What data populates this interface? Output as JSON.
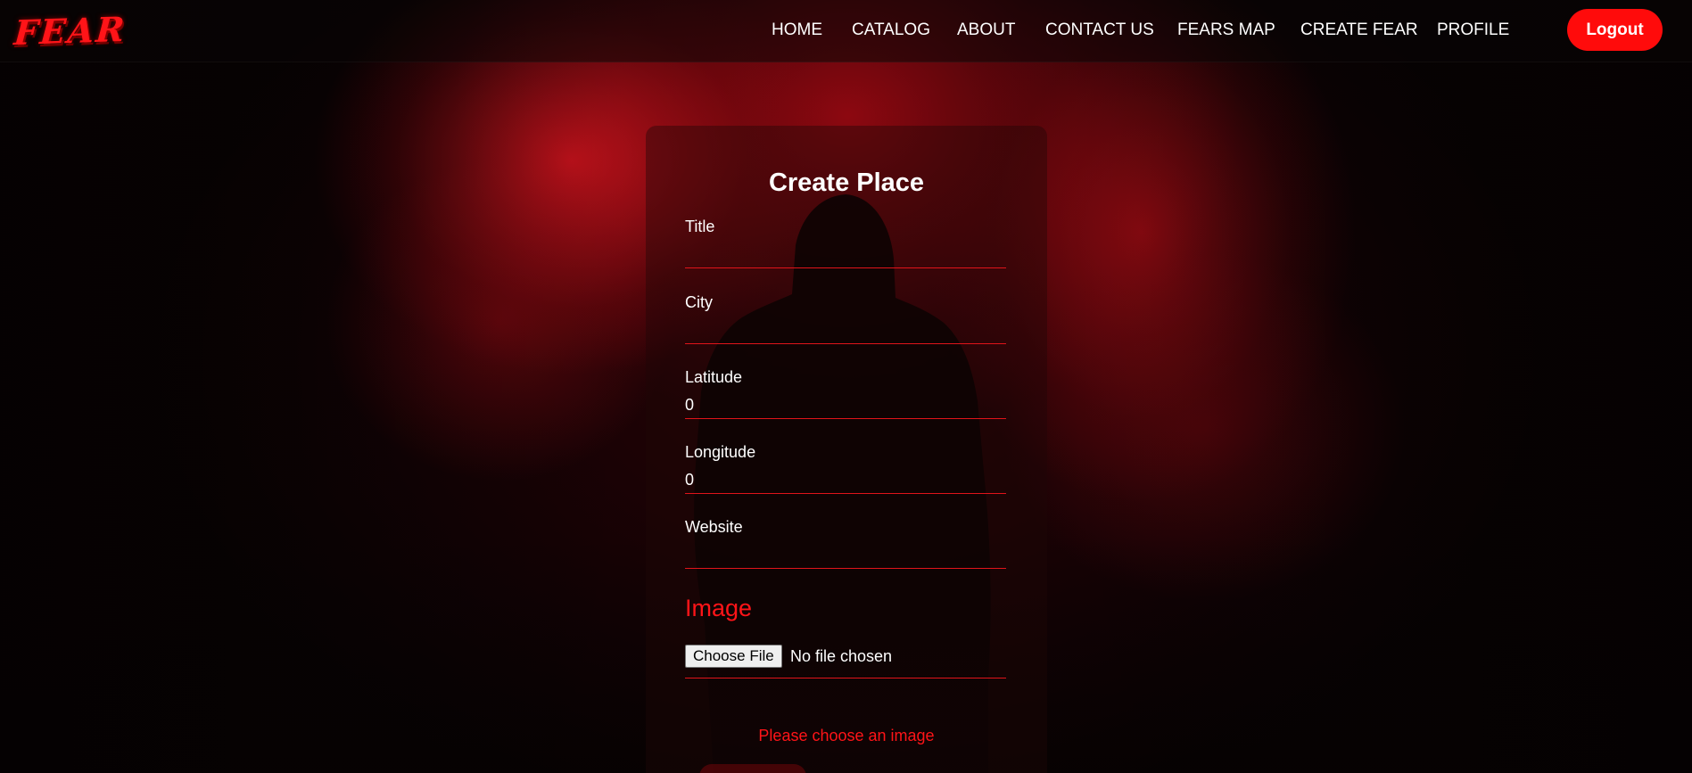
{
  "brand": {
    "logo_text": "FEAR"
  },
  "nav": {
    "links": [
      "HOME",
      "CATALOG",
      "ABOUT",
      "CONTACT US",
      "FEARS MAP",
      "CREATE FEAR",
      "PROFILE"
    ],
    "logout_label": "Logout"
  },
  "form": {
    "title": "Create Place",
    "fields": [
      {
        "label": "Title",
        "value": ""
      },
      {
        "label": "City",
        "value": ""
      },
      {
        "label": "Latitude",
        "value": "0"
      },
      {
        "label": "Longitude",
        "value": "0"
      },
      {
        "label": "Website",
        "value": ""
      }
    ],
    "image_heading": "Image",
    "file_button_label": "Choose File",
    "file_status": "No file chosen",
    "error": "Please choose an image"
  },
  "colors": {
    "accent": "#ff0b0b",
    "underline": "#e0141a",
    "background": "#070203"
  }
}
